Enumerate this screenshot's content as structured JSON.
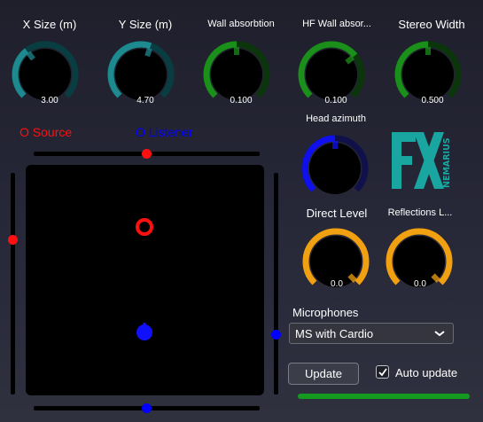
{
  "knobs": [
    {
      "id": "x-size",
      "title": "X Size (m)",
      "value": "3.00",
      "fraction": 0.36,
      "color": "#1c8a8f",
      "track": "#083e42"
    },
    {
      "id": "y-size",
      "title": "Y Size (m)",
      "value": "4.70",
      "fraction": 0.57,
      "color": "#1c8a8f",
      "track": "#083e42"
    },
    {
      "id": "wall-absorption",
      "title": "Wall absorbtion",
      "value": "0.100",
      "fraction": 0.5,
      "color": "#1a8f1a",
      "track": "#0b360b"
    },
    {
      "id": "hf-wall-absorption",
      "title": "HF Wall absor...",
      "value": "0.100",
      "fraction": 0.69,
      "color": "#1a8f1a",
      "track": "#0b360b"
    },
    {
      "id": "stereo-width",
      "title": "Stereo Width",
      "value": "0.500",
      "fraction": 0.5,
      "color": "#1a8f1a",
      "track": "#0b360b"
    },
    {
      "id": "head-azimuth",
      "title": "Head azimuth",
      "value": "",
      "fraction": 0.5,
      "color": "#1010ee",
      "track": "#10104a"
    },
    {
      "id": "direct-level",
      "title": "Direct Level",
      "value": "0.0",
      "fraction": 1.0,
      "color": "#f0a010",
      "track": "#5a3a08"
    },
    {
      "id": "reflections-level",
      "title": "Reflections L...",
      "value": "0.0",
      "fraction": 1.0,
      "color": "#f0a010",
      "track": "#5a3a08"
    }
  ],
  "legend": {
    "source": "O Source",
    "listener": "O Listener",
    "source_color": "#ff1010",
    "listener_color": "#0000ff"
  },
  "room": {
    "source_slider_x": 0.5,
    "source_slider_y": 0.7,
    "listener_slider_x": 0.5,
    "listener_slider_y": 0.27
  },
  "logo": {
    "letters": "FX",
    "side_text": "NEMARIUS",
    "color": "#1aa6a0"
  },
  "microphones": {
    "label": "Microphones",
    "selected": "MS with Cardio"
  },
  "update_button": "Update",
  "auto_update": {
    "label": "Auto update",
    "checked": true
  },
  "progress": 1.0
}
